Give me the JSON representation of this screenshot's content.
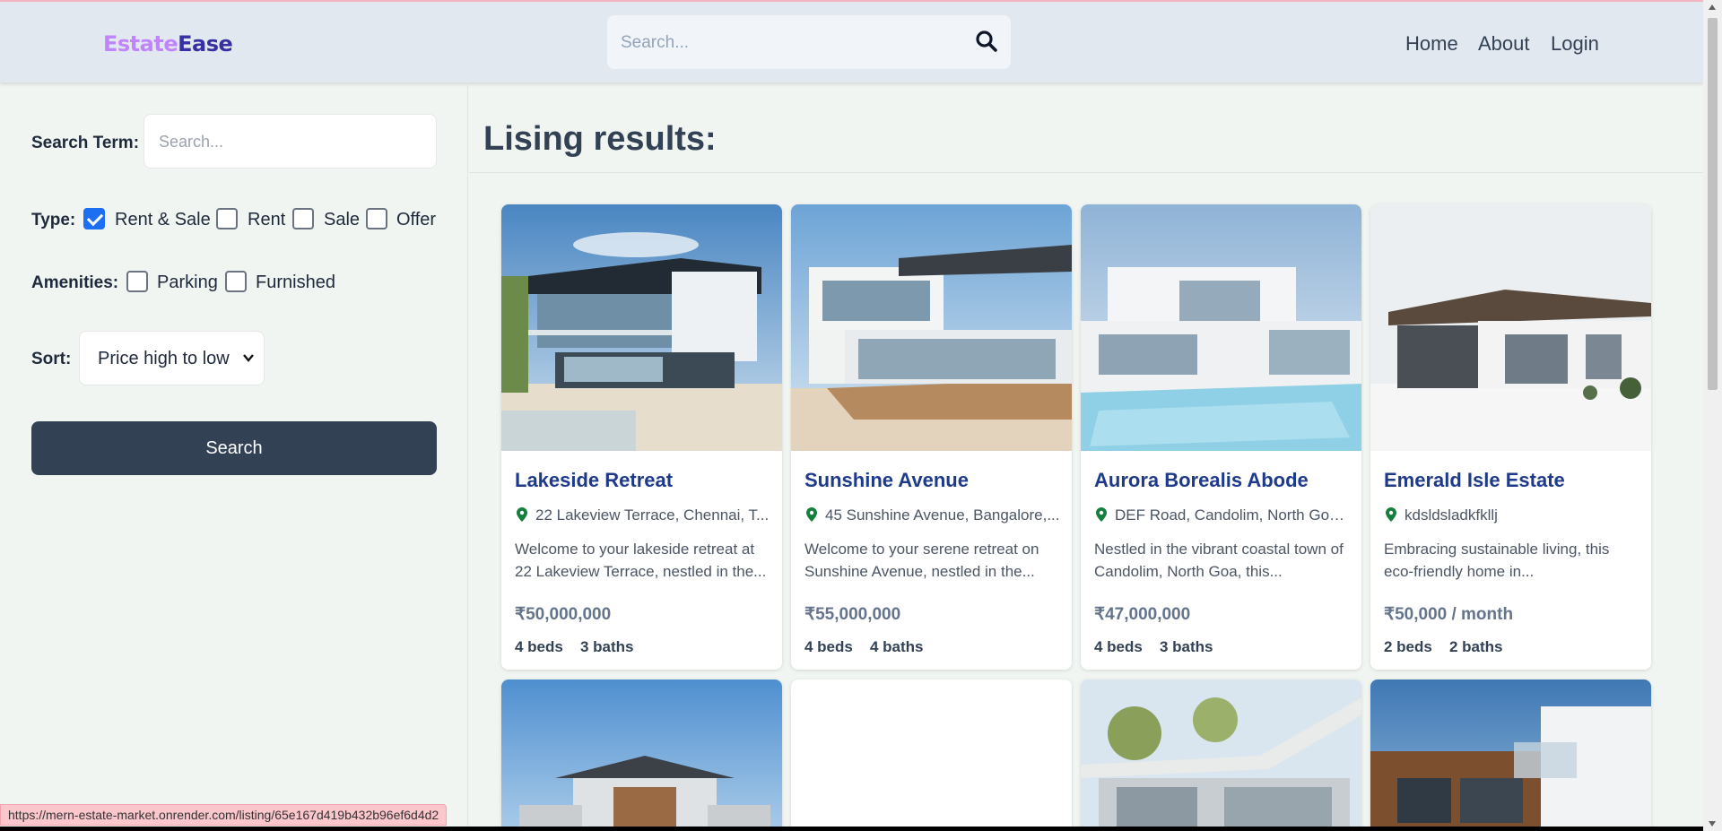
{
  "header": {
    "logo_part1": "Estate",
    "logo_part2": "Ease",
    "search_placeholder": "Search...",
    "nav": [
      "Home",
      "About",
      "Login"
    ]
  },
  "sidebar": {
    "search_term_label": "Search Term:",
    "search_placeholder": "Search...",
    "type_label": "Type:",
    "type_options": [
      {
        "label": "Rent & Sale",
        "checked": true
      },
      {
        "label": "Rent",
        "checked": false
      },
      {
        "label": "Sale",
        "checked": false
      },
      {
        "label": "Offer",
        "checked": false
      }
    ],
    "amenities_label": "Amenities:",
    "amenity_options": [
      {
        "label": "Parking",
        "checked": false
      },
      {
        "label": "Furnished",
        "checked": false
      }
    ],
    "sort_label": "Sort:",
    "sort_value": "Price high to low",
    "search_button": "Search"
  },
  "main": {
    "title": "Lising results:",
    "listings": [
      {
        "name": "Lakeside Retreat",
        "address": "22 Lakeview Terrace, Chennai, T...",
        "description": "Welcome to your lakeside retreat at 22 Lakeview Terrace, nestled in the...",
        "price": "₹50,000,000",
        "beds": "4 beds",
        "baths": "3 baths"
      },
      {
        "name": "Sunshine Avenue",
        "address": "45 Sunshine Avenue, Bangalore,...",
        "description": "Welcome to your serene retreat on Sunshine Avenue, nestled in the...",
        "price": "₹55,000,000",
        "beds": "4 beds",
        "baths": "4 baths"
      },
      {
        "name": "Aurora Borealis Abode",
        "address": "DEF Road, Candolim, North Goa...",
        "description": "Nestled in the vibrant coastal town of Candolim, North Goa, this...",
        "price": "₹47,000,000",
        "beds": "4 beds",
        "baths": "3 baths"
      },
      {
        "name": "Emerald Isle Estate",
        "address": "kdsldsladkfkllj",
        "description": "Embracing sustainable living, this eco-friendly home in...",
        "price": "₹50,000 / month",
        "beds": "2 beds",
        "baths": "2 baths"
      }
    ]
  },
  "status_url": "https://mern-estate-market.onrender.com/listing/65e167d419b432b96ef6d4d2",
  "colors": {
    "header_bg": "#e2e8f0",
    "logo_light": "#c084fc",
    "logo_dark": "#3730a3",
    "button_bg": "#334155",
    "listing_title": "#1e3a8a",
    "checkbox_on": "#1d6ff2",
    "pin": "#15803d"
  }
}
